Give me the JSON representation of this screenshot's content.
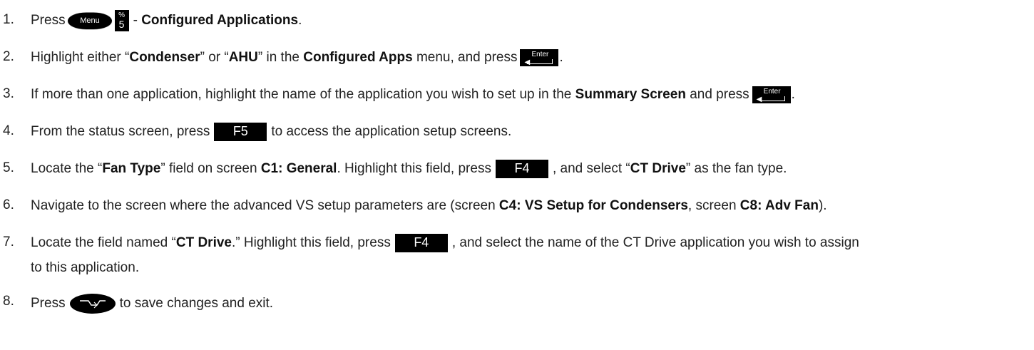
{
  "steps": [
    {
      "num": "1.",
      "parts": {
        "press": "Press",
        "menu_key": "Menu",
        "key5_top": "%",
        "key5_digit": "5",
        "dash": "-",
        "b1": "Configured Applications",
        "end": "."
      }
    },
    {
      "num": "2.",
      "parts": {
        "t1": "Highlight either “",
        "b1": "Condenser",
        "t2": "” or “",
        "b2": "AHU",
        "t3": "” in the",
        "b3": "Configured Apps",
        "t4": "menu, and press",
        "enter": "Enter",
        "end": "."
      }
    },
    {
      "num": "3.",
      "parts": {
        "t1": "If more than one application, highlight the name of the application you wish to set up in the",
        "b1": "Summary Screen",
        "t2": "and press",
        "enter": "Enter",
        "end": "."
      }
    },
    {
      "num": "4.",
      "parts": {
        "t1": "From the status screen, press",
        "key": "F5",
        "t2": "to access the application setup screens."
      }
    },
    {
      "num": "5.",
      "parts": {
        "t1": "Locate the “",
        "b1": "Fan Type",
        "t2": "” field on screen",
        "b2": "C1: General",
        "t3": ". Highlight this field, press",
        "key": "F4",
        "t4": ", and select “",
        "b3": "CT Drive",
        "t5": "” as the fan type."
      }
    },
    {
      "num": "6.",
      "parts": {
        "t1": "Navigate to the screen where the advanced VS setup parameters are (screen",
        "b1": "C4: VS Setup for Condensers",
        "t2": ", screen",
        "b2": "C8: Adv Fan",
        "t3": ")."
      }
    },
    {
      "num": "7.",
      "parts": {
        "t1": "Locate the field named “",
        "b1": "CT Drive",
        "t2": ".” Highlight this field, press",
        "key": "F4",
        "t3": ", and select the name of the CT Drive application you wish to assign",
        "line2": "to this application."
      }
    },
    {
      "num": "8.",
      "parts": {
        "t1": "Press",
        "t2": "to save changes and exit."
      }
    }
  ]
}
